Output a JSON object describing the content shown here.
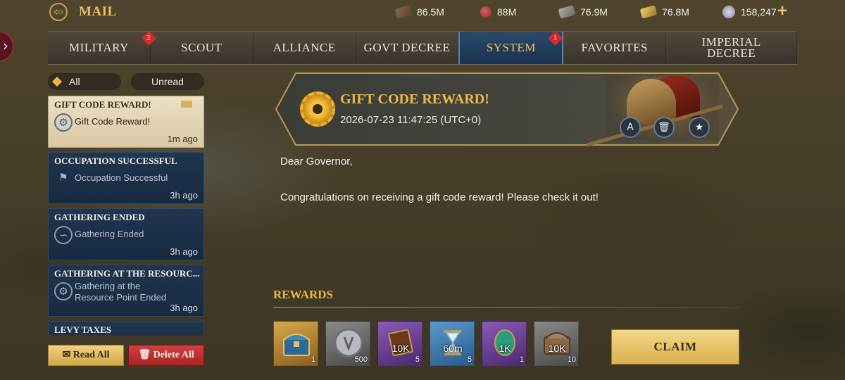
{
  "header": {
    "title": "MAIL",
    "back_icon": "back-arrow-icon"
  },
  "resources": [
    {
      "name": "wood",
      "value": "86.5M",
      "icon": "wood-icon"
    },
    {
      "name": "food",
      "value": "88M",
      "icon": "meat-icon"
    },
    {
      "name": "stone",
      "value": "76.9M",
      "icon": "stone-icon"
    },
    {
      "name": "gold",
      "value": "76.8M",
      "icon": "gold-bar-icon"
    },
    {
      "name": "silver",
      "value": "158,247",
      "icon": "silver-coin-icon"
    }
  ],
  "tabs": [
    {
      "label": "MILITARY",
      "badge": "2"
    },
    {
      "label": "SCOUT"
    },
    {
      "label": "ALLIANCE"
    },
    {
      "label": "GOVT DECREE"
    },
    {
      "label": "SYSTEM",
      "badge": "1",
      "active": true
    },
    {
      "label": "FAVORITES"
    },
    {
      "label": "IMPERIAL DECREE"
    }
  ],
  "filter": {
    "all": "All",
    "unread": "Unread"
  },
  "mail_list": [
    {
      "title": "GIFT CODE REWARD!",
      "subtitle": "Gift Code Reward!",
      "time": "1m ago",
      "icon": "gear-icon",
      "selected": true
    },
    {
      "title": "OCCUPATION SUCCESSFUL",
      "subtitle": "Occupation Successful",
      "time": "3h ago",
      "icon": "flag-icon"
    },
    {
      "title": "GATHERING ENDED",
      "subtitle": "Gathering Ended",
      "time": "3h ago",
      "icon": "sickle-icon"
    },
    {
      "title": "GATHERING AT THE RESOURC...",
      "subtitle": "Gathering at the Resource Point Ended",
      "time": "3h ago",
      "icon": "gear-icon"
    },
    {
      "title": "LEVY TAXES",
      "subtitle": "",
      "time": "",
      "icon": ""
    }
  ],
  "actions": {
    "read_all": "Read All",
    "delete_all": "Delete All"
  },
  "mail": {
    "title": "GIFT CODE REWARD!",
    "date": "2026-07-23 11:47:25 (UTC+0)",
    "greeting": "Dear Governor,",
    "body": "Congratulations on receiving a gift code reward! Please check it out!"
  },
  "rewards": {
    "title": "REWARDS",
    "items": [
      {
        "icon": "treasure-chest-icon",
        "label": "",
        "qty": "1",
        "rarity": "gold"
      },
      {
        "icon": "silver-coin-icon",
        "label": "",
        "qty": "500",
        "rarity": "grey"
      },
      {
        "icon": "book-icon",
        "label": "10K",
        "qty": "5",
        "rarity": "purple"
      },
      {
        "icon": "hourglass-icon",
        "label": "60m",
        "qty": "5",
        "rarity": "blue"
      },
      {
        "icon": "green-gem-icon",
        "label": "1K",
        "qty": "1",
        "rarity": "purple"
      },
      {
        "icon": "resource-chest-icon",
        "label": "10K",
        "qty": "10",
        "rarity": "grey"
      }
    ],
    "claim": "CLAIM"
  }
}
